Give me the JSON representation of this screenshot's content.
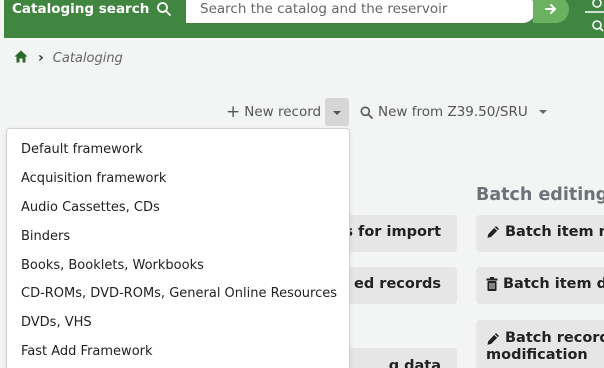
{
  "header": {
    "title": "Cataloging search",
    "search_placeholder": "Search the catalog and the reservoir",
    "search_icon": "search-icon",
    "submit_icon": "arrow-right-icon"
  },
  "breadcrumb": {
    "home_icon": "home-icon",
    "separator": "›",
    "current": "Cataloging"
  },
  "toolbar": {
    "new_record_label": "New record",
    "new_from_z3950_label": "New from Z39.50/SRU"
  },
  "dropdown": {
    "items": [
      "Default framework",
      "Acquisition framework",
      "Audio Cassettes, CDs",
      "Binders",
      "Books, Booklets, Workbooks",
      "CD-ROMs, DVD-ROMs, General Online Resources",
      "DVDs, VHS",
      "Fast Add Framework"
    ]
  },
  "left_cards": {
    "stage_import_partial": "s for import",
    "staged_records_partial": "ed records",
    "export_data_partial": "g data"
  },
  "batch_editing": {
    "title": "Batch editing",
    "item_modification_partial": "Batch item m",
    "item_deletion_partial": "Batch item d",
    "record_modification_line1": "Batch record",
    "record_modification_line2": "modification"
  },
  "colors": {
    "header_green": "#408540",
    "submit_green": "#6ab25f",
    "background": "#f3f4f4",
    "card_gray": "#e6e6e6"
  }
}
